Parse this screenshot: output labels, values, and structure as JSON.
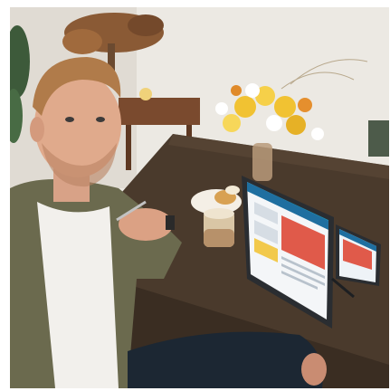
{
  "scene": {
    "colors": {
      "wall": "#ece9e3",
      "table": "#4a3a2c",
      "jacket": "#6b6a4e",
      "shirt": "#f2f0ec",
      "monitor_frame": "#2a2d31",
      "screen_accent": "#1f8fb0"
    }
  },
  "monitor": {
    "main_screen": {
      "header_label": ""
    },
    "side_screen": {
      "header_label": ""
    }
  }
}
